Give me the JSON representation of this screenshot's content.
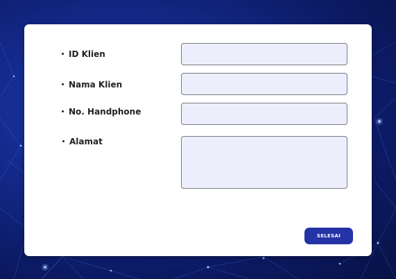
{
  "form": {
    "fields": [
      {
        "label": "ID Klien",
        "value": ""
      },
      {
        "label": "Nama Klien",
        "value": ""
      },
      {
        "label": "No. Handphone",
        "value": ""
      },
      {
        "label": "Alamat",
        "value": ""
      }
    ],
    "submit_label": "SELESAI"
  },
  "colors": {
    "background": "#142a8c",
    "field_fill": "#eceefc",
    "button": "#2433a6"
  }
}
